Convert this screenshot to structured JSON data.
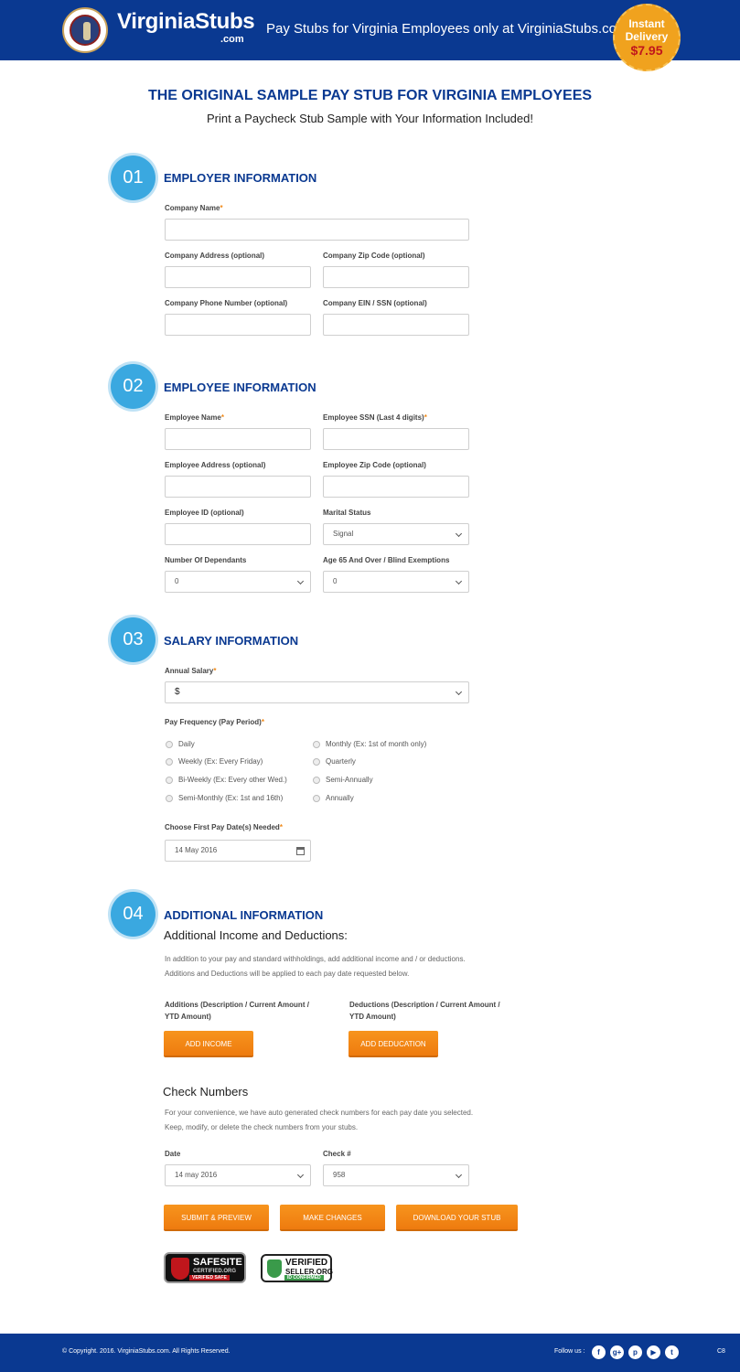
{
  "header": {
    "brand": "VirginiaStubs",
    "brand_sub": ".com",
    "tagline": "Pay Stubs for Virginia Employees only at VirginiaStubs.com!",
    "badge_line1": "Instant",
    "badge_line2": "Delivery",
    "badge_price": "$7.95"
  },
  "page": {
    "title": "THE ORIGINAL SAMPLE PAY STUB FOR VIRGINIA EMPLOYEES",
    "subtitle": "Print a Paycheck Stub Sample with Your Information Included!"
  },
  "employer": {
    "num": "01",
    "title": "EMPLOYER INFORMATION",
    "company_name": "Company Name",
    "company_address": "Company Address (optional)",
    "company_zip": "Company Zip Code (optional)",
    "company_phone": "Company Phone Number (optional)",
    "company_ein": "Company EIN / SSN (optional)"
  },
  "employee": {
    "num": "02",
    "title": "EMPLOYEE INFORMATION",
    "name": "Employee Name",
    "ssn": "Employee SSN (Last 4 digits)",
    "address": "Employee Address (optional)",
    "zip": "Employee Zip Code (optional)",
    "id": "Employee ID (optional)",
    "marital_label": "Marital Status",
    "marital_value": "Signal",
    "dependants_label": "Number Of Dependants",
    "dependants_value": "0",
    "exemptions_label": "Age 65 And Over / Blind Exemptions",
    "exemptions_value": "0"
  },
  "salary": {
    "num": "03",
    "title": "SALARY INFORMATION",
    "annual_label": "Annual Salary",
    "annual_value": "$",
    "freq_label": "Pay Frequency (Pay Period)",
    "options": [
      "Daily",
      "Weekly (Ex: Every Friday)",
      "Bi-Weekly (Ex: Every other Wed.)",
      "Semi-Monthly (Ex: 1st and 16th)",
      "Monthly (Ex: 1st of month only)",
      "Quarterly",
      "Semi-Annually",
      "Annually"
    ],
    "date_label": "Choose First Pay Date(s) Needed",
    "date_value": "14 May 2016"
  },
  "additional": {
    "num": "04",
    "title": "ADDITIONAL INFORMATION",
    "heading": "Additional Income and Deductions:",
    "para1": "In addition to your pay and standard withholdings, add additional income and / or deductions.",
    "para2": "Additions and Deductions will be applied to each pay date requested below.",
    "additions_label1": "Additions (Description / Current Amount /",
    "additions_label2": "YTD Amount)",
    "deductions_label1": "Deductions (Description / Current Amount /",
    "deductions_label2": "YTD Amount)",
    "add_income": "ADD INCOME",
    "add_deduction": "ADD DEDUCATION"
  },
  "check": {
    "heading": "Check Numbers",
    "para1": "For your convenience, we have auto generated check numbers for each pay date you selected.",
    "para2": "Keep, modify, or delete the check numbers from your stubs.",
    "date_label": "Date",
    "date_value": "14 may 2016",
    "check_label": "Check #",
    "check_value": "958"
  },
  "actions": {
    "submit": "SUBMIT & PREVIEW",
    "changes": "MAKE CHANGES",
    "download": "DOWNLOAD YOUR STUB"
  },
  "badges": {
    "safe1": "SAFESITE",
    "safe2": "CERTIFIED.ORG",
    "safe3": "VERIFIED SAFE",
    "ver1": "VERIFIED",
    "ver2": "SELLER.ORG",
    "ver3": "ID CONFIRMED"
  },
  "footer": {
    "copyright": "© Copyright. 2016. VirginiaStubs.com. All Rights Reserved.",
    "follow": "Follow us :",
    "code": "C8"
  }
}
